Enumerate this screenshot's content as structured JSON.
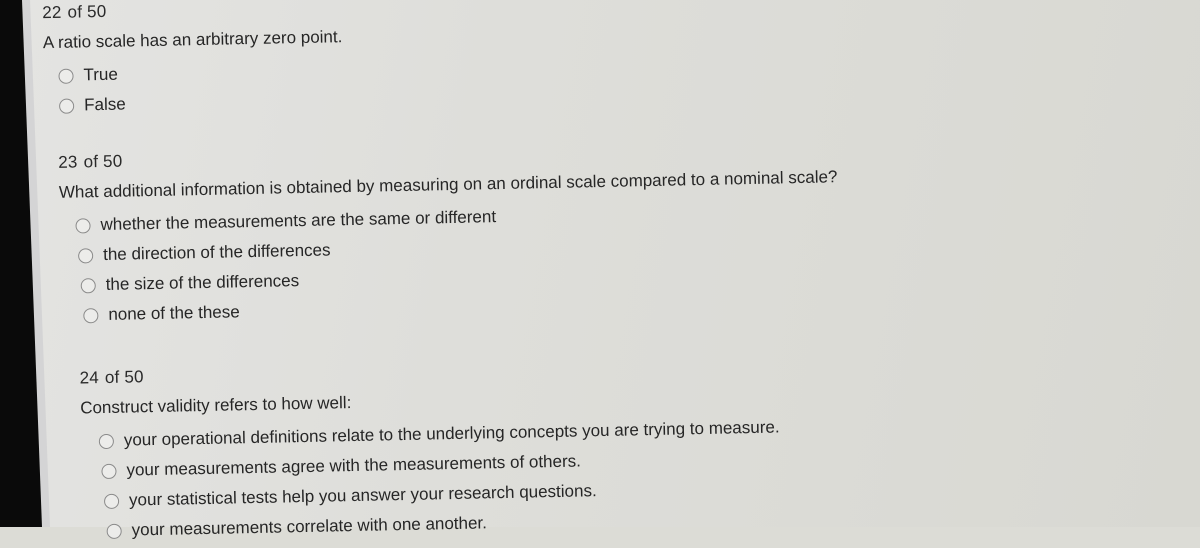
{
  "questions": [
    {
      "number": "22",
      "of_label": "of 50",
      "text": "A ratio scale has an arbitrary zero point.",
      "options": [
        {
          "label": "True",
          "selected": false
        },
        {
          "label": "False",
          "selected": false
        }
      ]
    },
    {
      "number": "23",
      "of_label": "of 50",
      "text": "What additional information is obtained by measuring on an ordinal scale compared to a nominal scale?",
      "options": [
        {
          "label": "whether the measurements are the same or different",
          "selected": false
        },
        {
          "label": "the direction of the differences",
          "selected": false
        },
        {
          "label": "the size of the differences",
          "selected": false
        },
        {
          "label": "none of the these",
          "selected": false
        }
      ]
    },
    {
      "number": "24",
      "of_label": "of 50",
      "text": "Construct validity refers to how well:",
      "options": [
        {
          "label": "your operational definitions relate to the underlying concepts you are trying to measure.",
          "selected": false
        },
        {
          "label": "your measurements agree with the measurements of others.",
          "selected": false
        },
        {
          "label": "your statistical tests help you answer your research questions.",
          "selected": false
        },
        {
          "label": "your measurements correlate with one another.",
          "selected": false
        }
      ]
    }
  ],
  "colors": {
    "background": "#dcdcd6",
    "text": "#262626",
    "radio_border": "#8a8a8a",
    "bezel": "#0a0a0a"
  }
}
